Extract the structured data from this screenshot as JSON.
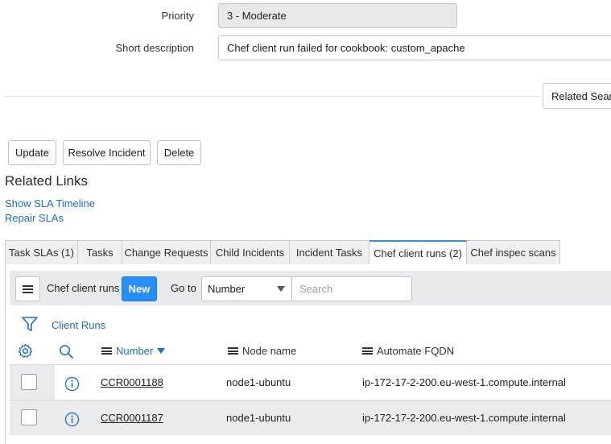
{
  "form": {
    "priority_label": "Priority",
    "priority_value": "3 - Moderate",
    "short_description_label": "Short description",
    "short_description_value": "Chef client run failed for cookbook: custom_apache",
    "related_search_label": "Related Search"
  },
  "actions": {
    "update": "Update",
    "resolve": "Resolve Incident",
    "delete": "Delete"
  },
  "related_links": {
    "title": "Related Links",
    "items": [
      "Show SLA Timeline",
      "Repair SLAs"
    ]
  },
  "tabs": [
    {
      "label": "Task SLAs (1)",
      "active": false
    },
    {
      "label": "Tasks",
      "active": false
    },
    {
      "label": "Change Requests",
      "active": false
    },
    {
      "label": "Child Incidents",
      "active": false
    },
    {
      "label": "Incident Tasks",
      "active": false
    },
    {
      "label": "Chef client runs (2)",
      "active": true
    },
    {
      "label": "Chef inspec scans",
      "active": false
    }
  ],
  "list": {
    "title": "Chef client runs",
    "new_label": "New",
    "goto_label": "Go to",
    "goto_field": "Number",
    "search_placeholder": "Search",
    "breadcrumb": "Client Runs",
    "columns": {
      "number": "Number",
      "node_name": "Node name",
      "fqdn": "Automate FQDN"
    },
    "rows": [
      {
        "number": "CCR0001188",
        "node_name": "node1-ubuntu",
        "fqdn": "ip-172-17-2-200.eu-west-1.compute.internal"
      },
      {
        "number": "CCR0001187",
        "node_name": "node1-ubuntu",
        "fqdn": "ip-172-17-2-200.eu-west-1.compute.internal"
      }
    ]
  },
  "colors": {
    "link": "#1f70c1",
    "primary_button": "#278efc",
    "active_tab_border": "#3c8edc"
  }
}
